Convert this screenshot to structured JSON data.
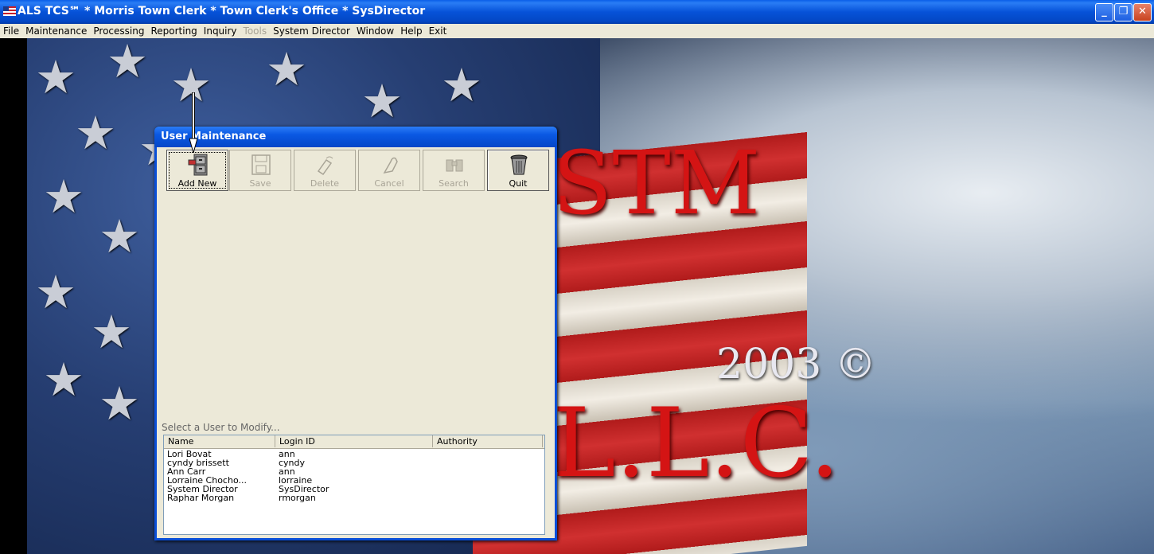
{
  "window": {
    "title": "ALS TCS℠ * Morris Town Clerk * Town Clerk's Office * SysDirector",
    "minimize": "_",
    "restore": "❐",
    "close": "✕"
  },
  "menu": [
    {
      "label": "File",
      "disabled": false
    },
    {
      "label": "Maintenance",
      "disabled": false
    },
    {
      "label": "Processing",
      "disabled": false
    },
    {
      "label": "Reporting",
      "disabled": false
    },
    {
      "label": "Inquiry",
      "disabled": false
    },
    {
      "label": "Tools",
      "disabled": true
    },
    {
      "label": "System Director",
      "disabled": false
    },
    {
      "label": "Window",
      "disabled": false
    },
    {
      "label": "Help",
      "disabled": false
    },
    {
      "label": "Exit",
      "disabled": false
    }
  ],
  "background": {
    "text_tm": "STM",
    "text_year": "2003 ©",
    "text_llc": "L.L.C."
  },
  "dialog": {
    "title": "User Maintenance",
    "toolbar": [
      {
        "label": "Add New",
        "icon": "file-cabinet-icon",
        "enabled": true
      },
      {
        "label": "Save",
        "icon": "floppy-disk-icon",
        "enabled": false
      },
      {
        "label": "Delete",
        "icon": "eraser-icon",
        "enabled": false
      },
      {
        "label": "Cancel",
        "icon": "cancel-hand-icon",
        "enabled": false
      },
      {
        "label": "Search",
        "icon": "binoculars-icon",
        "enabled": false
      },
      {
        "label": "Quit",
        "icon": "trash-can-icon",
        "enabled": true
      }
    ],
    "select_label": "Select a User to Modify...",
    "columns": [
      "Name",
      "Login ID",
      "Authority"
    ],
    "users": [
      {
        "name": "Lori Bovat",
        "login": "ann",
        "authority": ""
      },
      {
        "name": "cyndy brissett",
        "login": "cyndy",
        "authority": ""
      },
      {
        "name": "Ann Carr",
        "login": "ann",
        "authority": ""
      },
      {
        "name": "Lorraine Chocho...",
        "login": "lorraine",
        "authority": ""
      },
      {
        "name": "System Director",
        "login": "SysDirector",
        "authority": ""
      },
      {
        "name": "Raphar Morgan",
        "login": "rmorgan",
        "authority": ""
      }
    ]
  }
}
